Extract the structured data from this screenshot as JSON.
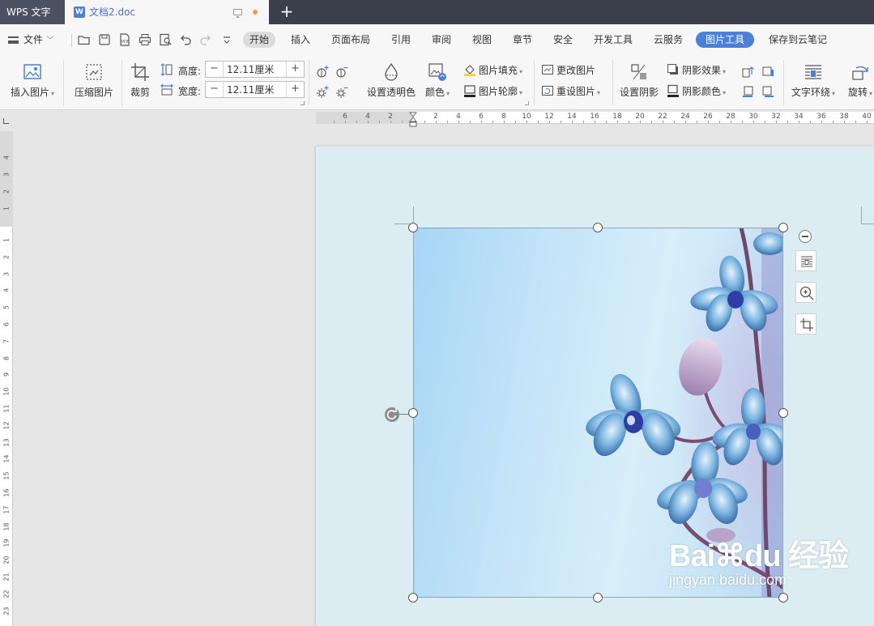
{
  "titlebar": {
    "app_name": "WPS 文字",
    "document_tab": "文档2.doc",
    "new_tab": "+"
  },
  "menubar": {
    "file_label": "文件",
    "items": [
      "开始",
      "插入",
      "页面布局",
      "引用",
      "审阅",
      "视图",
      "章节",
      "安全",
      "开发工具",
      "云服务",
      "图片工具",
      "保存到云笔记"
    ],
    "active_item": "图片工具",
    "highlighted_item": "开始"
  },
  "ribbon": {
    "insert_picture": "插入图片",
    "compress_picture": "压缩图片",
    "crop": "裁剪",
    "height_label": "高度:",
    "height_value": "12.11厘米",
    "width_label": "宽度:",
    "width_value": "12.11厘米",
    "set_transparent": "设置透明色",
    "color": "颜色",
    "picture_fill": "图片填充",
    "picture_outline": "图片轮廓",
    "change_picture": "更改图片",
    "reset_picture": "重设图片",
    "set_shadow": "设置阴影",
    "shadow_effect": "阴影效果",
    "shadow_color": "阴影颜色",
    "text_wrap": "文字环绕",
    "rotate": "旋转",
    "stepper_minus": "−",
    "stepper_plus": "+"
  },
  "ruler": {
    "horizontal_labels": [
      "6",
      "4",
      "2",
      "2",
      "4",
      "6",
      "8",
      "10",
      "12",
      "14",
      "16",
      "18",
      "20",
      "22",
      "24",
      "26",
      "28",
      "30",
      "32",
      "34",
      "36",
      "38",
      "40"
    ],
    "vertical_labels": [
      "4",
      "3",
      "2",
      "1",
      "1",
      "2",
      "3",
      "4",
      "5",
      "6",
      "7",
      "8",
      "9",
      "10",
      "11",
      "12",
      "13",
      "14",
      "15",
      "16",
      "17",
      "18",
      "19",
      "20",
      "21",
      "22",
      "23"
    ]
  },
  "watermark": {
    "brand": "Bai⌘du 经验",
    "url": "jingyan.baidu.com"
  },
  "colors": {
    "accent": "#4a80d8",
    "titlebar": "#3a3f4b",
    "page": "#dbedf2",
    "unsaved_dot": "#f39b3d"
  },
  "icons": [
    "hamburger-icon",
    "open-folder-icon",
    "save-icon",
    "pdf-icon",
    "print-icon",
    "print-preview-icon",
    "undo-icon",
    "redo-icon",
    "more-icon",
    "zoom-in-icon",
    "crop-icon",
    "text-wrap-icon",
    "rotate-icon"
  ]
}
